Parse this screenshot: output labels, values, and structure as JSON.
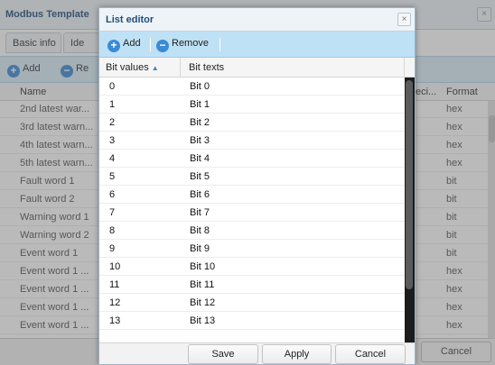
{
  "background_window": {
    "title": "Modbus Template",
    "tabs": [
      "Basic info",
      "Ide"
    ],
    "toolbar": {
      "add_label": "Add",
      "remove_label": "Re"
    },
    "columns": {
      "name": "Name",
      "description": "eci...",
      "format": "Format"
    },
    "rows": [
      {
        "name": "2nd latest war...",
        "format": "hex"
      },
      {
        "name": "3rd latest warn...",
        "format": "hex"
      },
      {
        "name": "4th latest warn...",
        "format": "hex"
      },
      {
        "name": "5th latest warn...",
        "format": "hex"
      },
      {
        "name": "Fault word 1",
        "format": "bit"
      },
      {
        "name": "Fault word 2",
        "format": "bit"
      },
      {
        "name": "Warning word 1",
        "format": "bit"
      },
      {
        "name": "Warning word 2",
        "format": "bit"
      },
      {
        "name": "Event word 1",
        "format": "bit"
      },
      {
        "name": "Event word 1 ...",
        "format": "hex"
      },
      {
        "name": "Event word 1 ...",
        "format": "hex"
      },
      {
        "name": "Event word 1 ...",
        "format": "hex"
      },
      {
        "name": "Event word 1 ...",
        "format": "hex"
      }
    ],
    "cancel_label": "Cancel",
    "close_glyph": "×"
  },
  "list_editor": {
    "title": "List editor",
    "close_glyph": "×",
    "toolbar": {
      "add_label": "Add",
      "remove_label": "Remove"
    },
    "columns": {
      "bit_values": "Bit values",
      "bit_texts": "Bit texts",
      "sort_glyph": "▲"
    },
    "rows": [
      {
        "value": "0",
        "text": "Bit 0"
      },
      {
        "value": "1",
        "text": "Bit 1"
      },
      {
        "value": "2",
        "text": "Bit 2"
      },
      {
        "value": "3",
        "text": "Bit 3"
      },
      {
        "value": "4",
        "text": "Bit 4"
      },
      {
        "value": "5",
        "text": "Bit 5"
      },
      {
        "value": "6",
        "text": "Bit 6"
      },
      {
        "value": "7",
        "text": "Bit 7"
      },
      {
        "value": "8",
        "text": "Bit 8"
      },
      {
        "value": "9",
        "text": "Bit 9"
      },
      {
        "value": "10",
        "text": "Bit 10"
      },
      {
        "value": "11",
        "text": "Bit 11"
      },
      {
        "value": "12",
        "text": "Bit 12"
      },
      {
        "value": "13",
        "text": "Bit 13"
      }
    ],
    "buttons": {
      "save": "Save",
      "apply": "Apply",
      "cancel": "Cancel"
    }
  },
  "icons": {
    "add": "plus-circle-icon",
    "remove": "minus-circle-icon",
    "close": "close-icon"
  },
  "colors": {
    "accent": "#3b8ad6",
    "toolbar": "#bfe1f6",
    "title_text": "#1f4e7a"
  }
}
